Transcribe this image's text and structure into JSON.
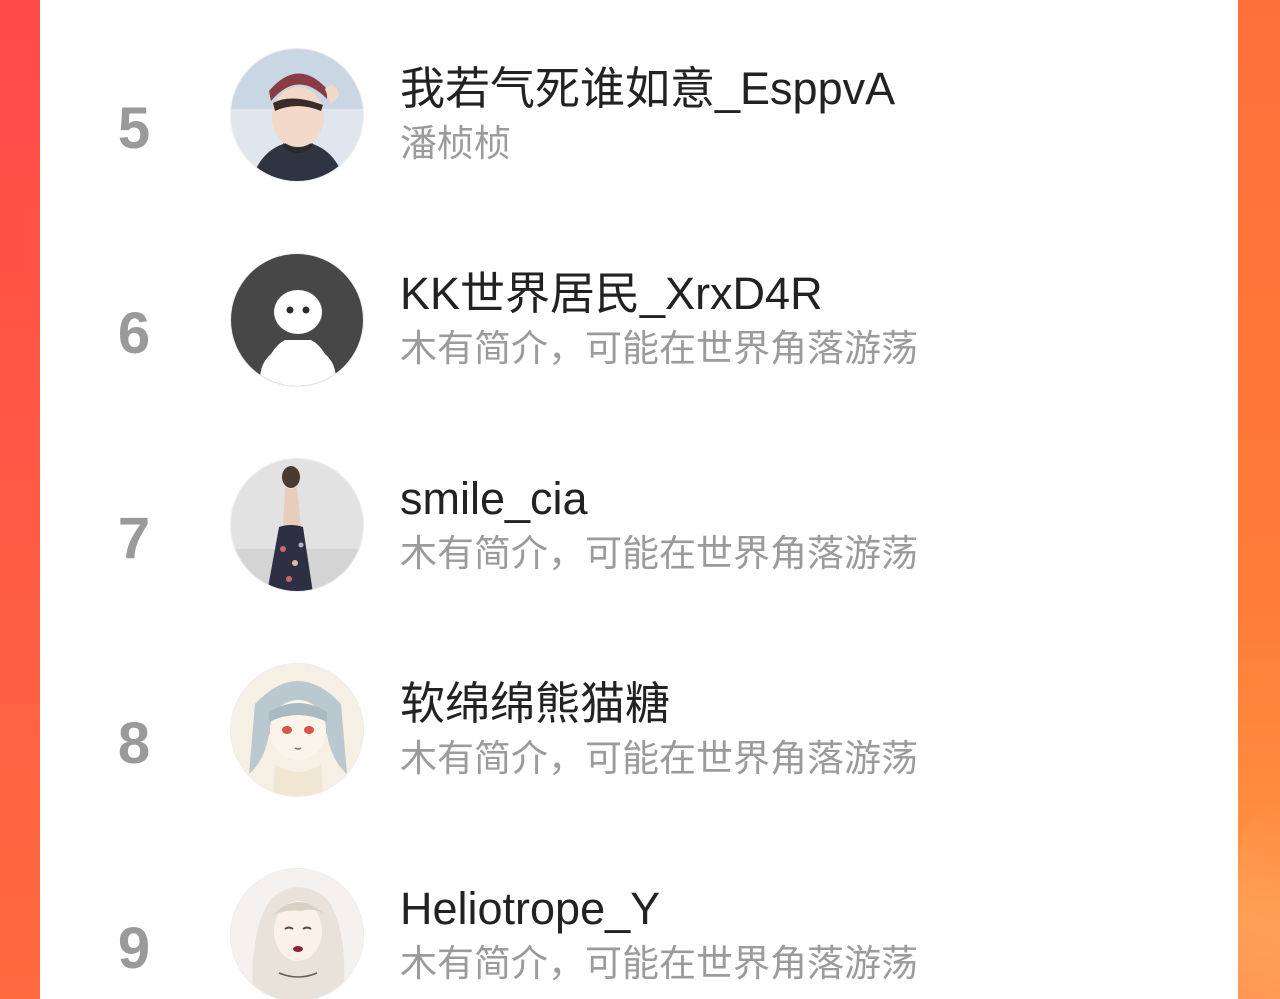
{
  "users": [
    {
      "rank": "5",
      "name": "我若气死谁如意_EsppvA",
      "bio": "潘桢桢",
      "avatar": "avatar-boy-hat"
    },
    {
      "rank": "6",
      "name": "KK世界居民_XrxD4R",
      "bio": "木有简介，可能在世界角落游荡",
      "avatar": "avatar-default-ghost"
    },
    {
      "rank": "7",
      "name": "smile_cia",
      "bio": "木有简介，可能在世界角落游荡",
      "avatar": "avatar-girl-dress"
    },
    {
      "rank": "8",
      "name": "软绵绵熊猫糖",
      "bio": "木有简介，可能在世界角落游荡",
      "avatar": "avatar-anime-girl"
    },
    {
      "rank": "9",
      "name": "Heliotrope_Y",
      "bio": "木有简介，可能在世界角落游荡",
      "avatar": "avatar-illustrated-girl"
    }
  ],
  "colors": {
    "accent_left": "#ff4a48",
    "accent_right": "#ff7c38",
    "rank": "#9a9a9a",
    "name": "#222222",
    "bio": "#9b9b9b"
  }
}
